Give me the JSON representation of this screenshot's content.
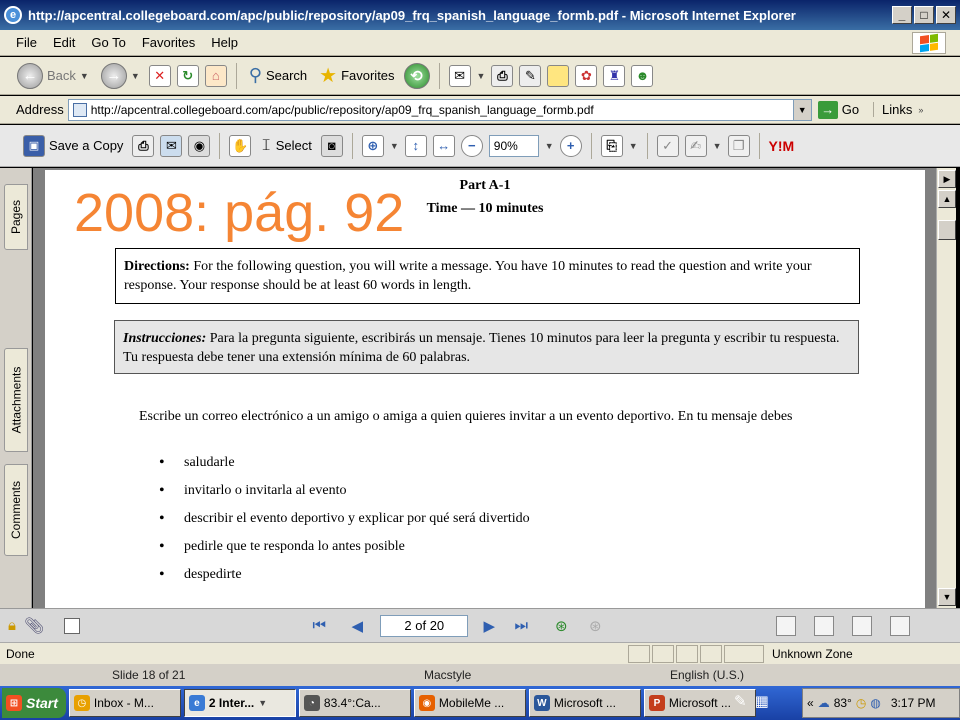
{
  "window": {
    "title": "http://apcentral.collegeboard.com/apc/public/repository/ap09_frq_spanish_language_formb.pdf - Microsoft Internet Explorer",
    "btn_minimize": "_",
    "btn_maximize": "□",
    "btn_close": "✕"
  },
  "menu": [
    "File",
    "Edit",
    "Go To",
    "Favorites",
    "Help"
  ],
  "toolbar": {
    "back": "Back",
    "search": "Search",
    "favorites": "Favorites"
  },
  "address": {
    "label": "Address",
    "url": "http://apcentral.collegeboard.com/apc/public/repository/ap09_frq_spanish_language_formb.pdf",
    "go": "Go",
    "links": "Links"
  },
  "reader_toolbar": {
    "save_copy": "Save a Copy",
    "select": "Select",
    "zoom": "90%",
    "yahoo": "Y!M"
  },
  "side_tabs": {
    "pages": "Pages",
    "attachments": "Attachments",
    "comments": "Comments"
  },
  "document": {
    "overlay": "2008:  pág. 92",
    "part": "Part A-1",
    "time": "Time — 10 minutes",
    "directions_label": "Directions:",
    "directions_text": "For the following question, you will write a message.  You have 10 minutes to read the question and write your response.  Your response should be at least 60 words in length.",
    "instrucciones_label": "Instrucciones:",
    "instrucciones_text": "Para la pregunta siguiente, escribirás un mensaje.  Tienes 10 minutos para leer la pregunta y escribir tu respuesta.  Tu respuesta debe tener una extensión mínima de 60 palabras.",
    "prompt": "Escribe un correo electrónico a un amigo o amiga a quien quieres invitar a un evento deportivo. En tu mensaje debes",
    "bullets": [
      "saludarle",
      "invitarlo o invitarla al evento",
      "describir el evento deportivo y explicar por qué será divertido",
      "pedirle que te responda lo antes posible",
      "despedirte"
    ]
  },
  "navigation": {
    "page": "2 of 20"
  },
  "status": {
    "done": "Done",
    "zone": "Unknown Zone"
  },
  "slide_info": {
    "slide": "Slide 18 of 21",
    "theme": "Macstyle",
    "language": "English (U.S.)"
  },
  "taskbar": {
    "start": "Start",
    "tasks": [
      "Inbox - M...",
      "2 Inter...",
      "83.4°:Ca...",
      "MobileMe ...",
      "Microsoft ...",
      "Microsoft ..."
    ],
    "temp": "83°",
    "clock": "3:17 PM"
  },
  "colors": {
    "overlay": "#f58534",
    "titlebar": "#0a246a"
  }
}
